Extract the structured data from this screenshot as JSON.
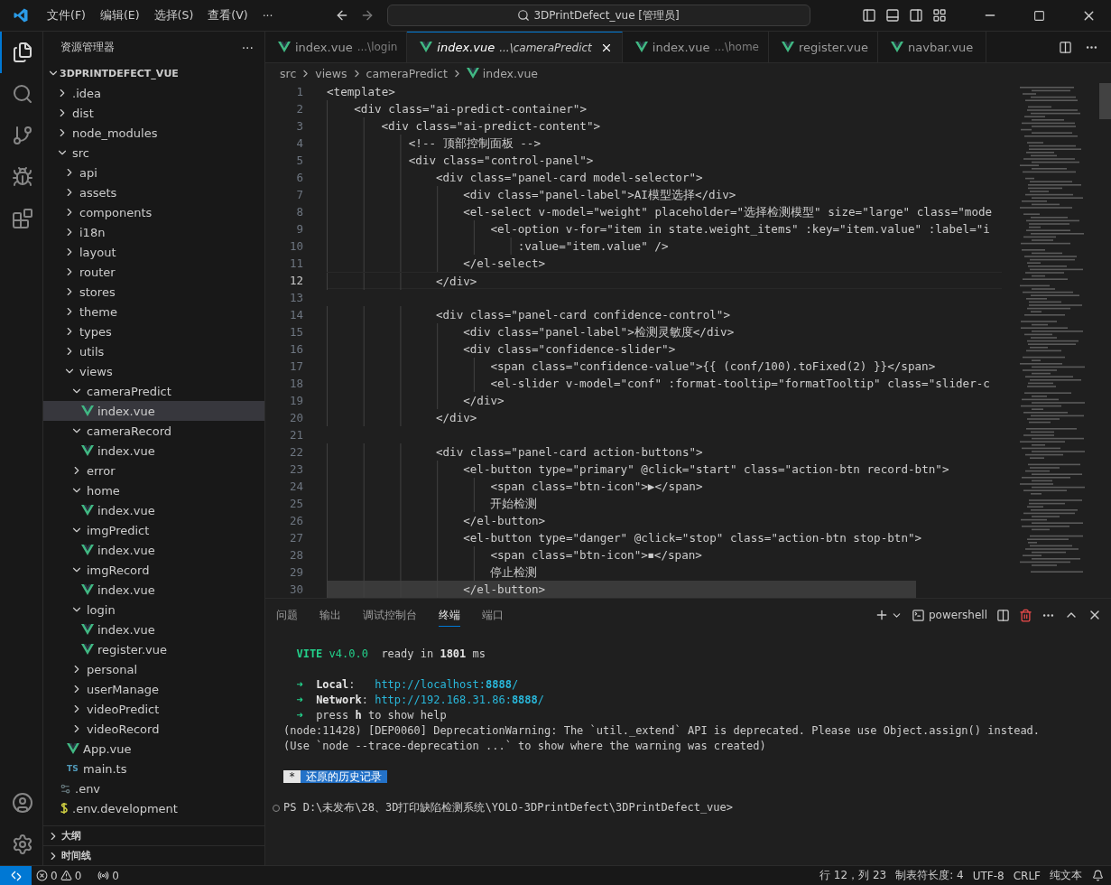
{
  "title_bar": {
    "menus": [
      "文件(F)",
      "编辑(E)",
      "选择(S)",
      "查看(V)",
      "···"
    ],
    "command_center": "3DPrintDefect_vue [管理员]"
  },
  "sidebar": {
    "title": "资源管理器",
    "more": "···",
    "project": "3DPRINTDEFECT_VUE",
    "tree": [
      {
        "label": ".idea",
        "kind": "folder",
        "expanded": false,
        "selected": false
      },
      {
        "label": "dist",
        "kind": "folder",
        "expanded": false,
        "selected": false
      },
      {
        "label": "node_modules",
        "kind": "folder",
        "expanded": false,
        "selected": false
      },
      {
        "label": "src",
        "kind": "folder",
        "expanded": true,
        "selected": false,
        "children": [
          {
            "label": "api",
            "kind": "folder",
            "expanded": false,
            "selected": false
          },
          {
            "label": "assets",
            "kind": "folder",
            "expanded": false,
            "selected": false
          },
          {
            "label": "components",
            "kind": "folder",
            "expanded": false,
            "selected": false
          },
          {
            "label": "i18n",
            "kind": "folder",
            "expanded": false,
            "selected": false
          },
          {
            "label": "layout",
            "kind": "folder",
            "expanded": false,
            "selected": false
          },
          {
            "label": "router",
            "kind": "folder",
            "expanded": false,
            "selected": false
          },
          {
            "label": "stores",
            "kind": "folder",
            "expanded": false,
            "selected": false
          },
          {
            "label": "theme",
            "kind": "folder",
            "expanded": false,
            "selected": false
          },
          {
            "label": "types",
            "kind": "folder",
            "expanded": false,
            "selected": false
          },
          {
            "label": "utils",
            "kind": "folder",
            "expanded": false,
            "selected": false
          },
          {
            "label": "views",
            "kind": "folder",
            "expanded": true,
            "selected": false,
            "children": [
              {
                "label": "cameraPredict",
                "kind": "folder",
                "expanded": true,
                "selected": false,
                "children": [
                  {
                    "label": "index.vue",
                    "kind": "vue",
                    "selected": true
                  }
                ]
              },
              {
                "label": "cameraRecord",
                "kind": "folder",
                "expanded": true,
                "selected": false,
                "children": [
                  {
                    "label": "index.vue",
                    "kind": "vue",
                    "selected": false
                  }
                ]
              },
              {
                "label": "error",
                "kind": "folder",
                "expanded": false,
                "selected": false
              },
              {
                "label": "home",
                "kind": "folder",
                "expanded": true,
                "selected": false,
                "children": [
                  {
                    "label": "index.vue",
                    "kind": "vue",
                    "selected": false
                  }
                ]
              },
              {
                "label": "imgPredict",
                "kind": "folder",
                "expanded": true,
                "selected": false,
                "children": [
                  {
                    "label": "index.vue",
                    "kind": "vue",
                    "selected": false
                  }
                ]
              },
              {
                "label": "imgRecord",
                "kind": "folder",
                "expanded": true,
                "selected": false,
                "children": [
                  {
                    "label": "index.vue",
                    "kind": "vue",
                    "selected": false
                  }
                ]
              },
              {
                "label": "login",
                "kind": "folder",
                "expanded": true,
                "selected": false,
                "children": [
                  {
                    "label": "index.vue",
                    "kind": "vue",
                    "selected": false
                  },
                  {
                    "label": "register.vue",
                    "kind": "vue",
                    "selected": false
                  }
                ]
              },
              {
                "label": "personal",
                "kind": "folder",
                "expanded": false,
                "selected": false
              },
              {
                "label": "userManage",
                "kind": "folder",
                "expanded": false,
                "selected": false
              },
              {
                "label": "videoPredict",
                "kind": "folder",
                "expanded": false,
                "selected": false
              },
              {
                "label": "videoRecord",
                "kind": "folder",
                "expanded": false,
                "selected": false
              }
            ]
          },
          {
            "label": "App.vue",
            "kind": "vue",
            "selected": false
          },
          {
            "label": "main.ts",
            "kind": "ts",
            "icon_text": "TS",
            "selected": false
          }
        ]
      },
      {
        "label": ".env",
        "kind": "config",
        "selected": false
      },
      {
        "label": ".env.development",
        "kind": "dollar",
        "selected": false
      }
    ],
    "sections": [
      {
        "label": "大纲",
        "expanded": false
      },
      {
        "label": "时间线",
        "expanded": false
      }
    ]
  },
  "tabs": [
    {
      "name": "index.vue",
      "path": "...\\login",
      "selected": false
    },
    {
      "name": "index.vue",
      "path": "...\\cameraPredict",
      "selected": true
    },
    {
      "name": "index.vue",
      "path": "...\\home",
      "selected": false
    },
    {
      "name": "register.vue",
      "selected": false
    },
    {
      "name": "navbar.vue",
      "selected": false
    }
  ],
  "breadcrumb": [
    "src",
    "views",
    "cameraPredict",
    "index.vue"
  ],
  "code_lines": [
    {
      "number": "1",
      "text": "<template>",
      "kind": "normal"
    },
    {
      "number": "2",
      "text": "    <div class=\"ai-predict-container\">",
      "kind": "normal"
    },
    {
      "number": "3",
      "text": "        <div class=\"ai-predict-content\">",
      "kind": "normal"
    },
    {
      "number": "4",
      "text": "            <!-- 顶部控制面板 -->",
      "kind": "normal"
    },
    {
      "number": "5",
      "text": "            <div class=\"control-panel\">",
      "kind": "normal"
    },
    {
      "number": "6",
      "text": "                <div class=\"panel-card model-selector\">",
      "kind": "normal"
    },
    {
      "number": "7",
      "text": "                    <div class=\"panel-label\">AI模型选择</div>",
      "kind": "normal"
    },
    {
      "number": "8",
      "text": "                    <el-select v-model=\"weight\" placeholder=\"选择检测模型\" size=\"large\" class=\"mode",
      "kind": "normal"
    },
    {
      "number": "9",
      "text": "                        <el-option v-for=\"item in state.weight_items\" :key=\"item.value\" :label=\"i",
      "kind": "normal"
    },
    {
      "number": "10",
      "text": "                            :value=\"item.value\" />",
      "kind": "normal"
    },
    {
      "number": "11",
      "text": "                    </el-select>",
      "kind": "normal"
    },
    {
      "number": "12",
      "text": "                </div>",
      "kind": "current"
    },
    {
      "number": "13",
      "kind": "normal"
    },
    {
      "number": "14",
      "text": "                <div class=\"panel-card confidence-control\">",
      "kind": "normal"
    },
    {
      "number": "15",
      "text": "                    <div class=\"panel-label\">检测灵敏度</div>",
      "kind": "normal"
    },
    {
      "number": "16",
      "text": "                    <div class=\"confidence-slider\">",
      "kind": "normal"
    },
    {
      "number": "17",
      "text": "                        <span class=\"confidence-value\">{{ (conf/100).toFixed(2) }}</span>",
      "kind": "normal"
    },
    {
      "number": "18",
      "text": "                        <el-slider v-model=\"conf\" :format-tooltip=\"formatTooltip\" class=\"slider-c",
      "kind": "normal"
    },
    {
      "number": "19",
      "text": "                    </div>",
      "kind": "normal"
    },
    {
      "number": "20",
      "text": "                </div>",
      "kind": "normal"
    },
    {
      "number": "21",
      "kind": "normal"
    },
    {
      "number": "22",
      "text": "                <div class=\"panel-card action-buttons\">",
      "kind": "normal"
    },
    {
      "number": "23",
      "text": "                    <el-button type=\"primary\" @click=\"start\" class=\"action-btn record-btn\">",
      "kind": "normal"
    },
    {
      "number": "24",
      "text": "                        <span class=\"btn-icon\">▶</span>",
      "kind": "normal"
    },
    {
      "number": "25",
      "text": "                        开始检测",
      "kind": "normal"
    },
    {
      "number": "26",
      "text": "                    </el-button>",
      "kind": "normal"
    },
    {
      "number": "27",
      "text": "                    <el-button type=\"danger\" @click=\"stop\" class=\"action-btn stop-btn\">",
      "kind": "normal"
    },
    {
      "number": "28",
      "text": "                        <span class=\"btn-icon\">⏹</span>",
      "kind": "normal"
    },
    {
      "number": "29",
      "text": "                        停止检测",
      "kind": "normal"
    },
    {
      "number": "30",
      "text": "                    </el-button>",
      "kind": "highlight"
    }
  ],
  "panel": {
    "tabs": [
      {
        "label": "问题",
        "selected": false
      },
      {
        "label": "输出",
        "selected": false
      },
      {
        "label": "调试控制台",
        "selected": false
      },
      {
        "label": "终端",
        "selected": true
      },
      {
        "label": "端口",
        "selected": false
      }
    ],
    "shell": "powershell",
    "terminal": [
      {
        "kind": "blank"
      },
      {
        "kind": "output",
        "segments": [
          {
            "kind": "accent-bold",
            "text": "  VITE"
          },
          {
            "kind": "accent",
            "text": " v4.0.0"
          },
          {
            "kind": "plain",
            "text": "  ready in "
          },
          {
            "kind": "bold",
            "text": "1801"
          },
          {
            "kind": "plain",
            "text": " ms"
          }
        ]
      },
      {
        "kind": "blank"
      },
      {
        "kind": "output",
        "segments": [
          {
            "kind": "accent",
            "text": "  ➜"
          },
          {
            "kind": "bold",
            "text": "  Local"
          },
          {
            "kind": "plain",
            "text": ":   "
          },
          {
            "kind": "link",
            "text": "http://localhost:"
          },
          {
            "kind": "link-bold",
            "text": "8888"
          },
          {
            "kind": "link",
            "text": "/"
          }
        ]
      },
      {
        "kind": "output",
        "segments": [
          {
            "kind": "accent",
            "text": "  ➜"
          },
          {
            "kind": "bold",
            "text": "  Network"
          },
          {
            "kind": "plain",
            "text": ": "
          },
          {
            "kind": "link",
            "text": "http://192.168.31.86:"
          },
          {
            "kind": "link-bold",
            "text": "8888"
          },
          {
            "kind": "link",
            "text": "/"
          }
        ]
      },
      {
        "kind": "output",
        "segments": [
          {
            "kind": "accent",
            "text": "  ➜"
          },
          {
            "kind": "plain",
            "text": "  press "
          },
          {
            "kind": "bold",
            "text": "h"
          },
          {
            "kind": "plain",
            "text": " to show help"
          }
        ]
      },
      {
        "kind": "output",
        "segments": [
          {
            "kind": "plain",
            "text": "(node:11428) [DEP0060] DeprecationWarning: The `util._extend` API is deprecated. Please use Object.assign() instead."
          }
        ]
      },
      {
        "kind": "output",
        "segments": [
          {
            "kind": "plain",
            "text": "(Use `node --trace-deprecation ...` to show where the warning was created)"
          }
        ]
      },
      {
        "kind": "blank"
      },
      {
        "kind": "output",
        "segments": [
          {
            "kind": "star-badge",
            "text": "*"
          },
          {
            "kind": "history-badge",
            "text": "还原的历史记录"
          }
        ]
      },
      {
        "kind": "blank"
      },
      {
        "kind": "prompt",
        "segments": [
          {
            "kind": "plain",
            "text": "PS D:\\未发布\\28、3D打印缺陷检测系统\\YOLO-3DPrintDefect\\3DPrintDefect_vue>"
          }
        ]
      }
    ]
  },
  "status_bar": {
    "errors": "0",
    "warnings": "0",
    "ports": "0",
    "right": [
      "行 12，列 23",
      "制表符长度: 4",
      "UTF-8",
      "CRLF",
      "纯文本"
    ]
  }
}
